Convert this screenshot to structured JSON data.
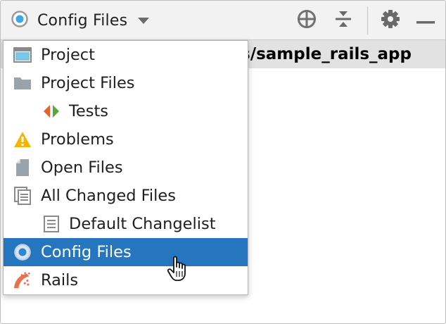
{
  "toolbar": {
    "view_label": "Config Files",
    "view_icon": "config-files-icon",
    "dropdown_icon": "chevron-down-icon",
    "buttons": [
      {
        "name": "locate-icon"
      },
      {
        "name": "collapse-all-icon"
      },
      {
        "name": "gear-icon"
      },
      {
        "name": "minimize-icon"
      }
    ]
  },
  "background": {
    "path_text": "s/sample_rails_app"
  },
  "menu": {
    "items": [
      {
        "label": "Project",
        "icon": "project-window-icon",
        "selected": false
      },
      {
        "label": "Project Files",
        "icon": "folder-icon",
        "selected": false
      },
      {
        "label": "Tests",
        "icon": "tests-icon",
        "selected": false
      },
      {
        "label": "Problems",
        "icon": "warning-icon",
        "selected": false
      },
      {
        "label": "Open Files",
        "icon": "file-icon",
        "selected": false
      },
      {
        "label": "All Changed Files",
        "icon": "changed-files-icon",
        "selected": false
      },
      {
        "label": "Default Changelist",
        "icon": "changelist-icon",
        "selected": false
      },
      {
        "label": "Config Files",
        "icon": "config-files-icon",
        "selected": true
      },
      {
        "label": "Rails",
        "icon": "rails-icon",
        "selected": false
      }
    ]
  },
  "colors": {
    "selection": "#2675bf",
    "toolbar_bg": "#f2f2f2",
    "path_bar_bg": "#e2e2e2",
    "warning": "#f4b400",
    "rails": "#e8714f"
  }
}
